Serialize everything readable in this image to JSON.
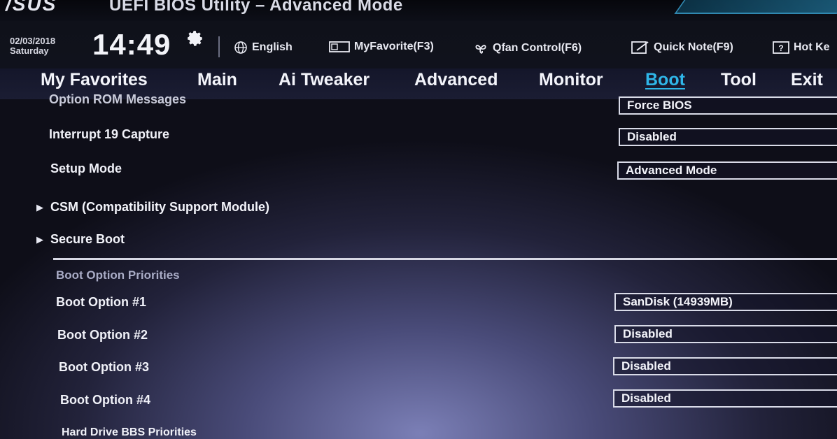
{
  "header": {
    "logo": "/SUS",
    "title": "UEFI BIOS Utility – Advanced Mode"
  },
  "info": {
    "date": "02/03/2018",
    "day": "Saturday",
    "time": "14:49",
    "language": "English",
    "my_favorite": "MyFavorite(F3)",
    "qfan": "Qfan Control(F6)",
    "quick_note": "Quick Note(F9)",
    "hot_keys": "Hot Ke"
  },
  "tabs": [
    {
      "label": "My Favorites"
    },
    {
      "label": "Main"
    },
    {
      "label": "Ai Tweaker"
    },
    {
      "label": "Advanced"
    },
    {
      "label": "Monitor"
    },
    {
      "label": "Boot",
      "active": true
    },
    {
      "label": "Tool"
    },
    {
      "label": "Exit"
    }
  ],
  "settings": {
    "option_rom": {
      "label": "Option ROM Messages",
      "value": "Force BIOS"
    },
    "interrupt19": {
      "label": "Interrupt 19 Capture",
      "value": "Disabled"
    },
    "setup_mode": {
      "label": "Setup Mode",
      "value": "Advanced Mode"
    }
  },
  "submenus": {
    "csm": "CSM (Compatibility Support Module)",
    "secure_boot": "Secure Boot"
  },
  "boot_priorities": {
    "heading": "Boot Option Priorities",
    "options": [
      {
        "label": "Boot Option #1",
        "value": "SanDisk  (14939MB)"
      },
      {
        "label": "Boot Option #2",
        "value": "Disabled"
      },
      {
        "label": "Boot Option #3",
        "value": "Disabled"
      },
      {
        "label": "Boot Option #4",
        "value": "Disabled"
      }
    ]
  },
  "hdd_bbs": "Hard Drive BBS Priorities",
  "colors": {
    "accent": "#2fb6e8",
    "text": "#f0f1f8",
    "background": "#22223a"
  }
}
